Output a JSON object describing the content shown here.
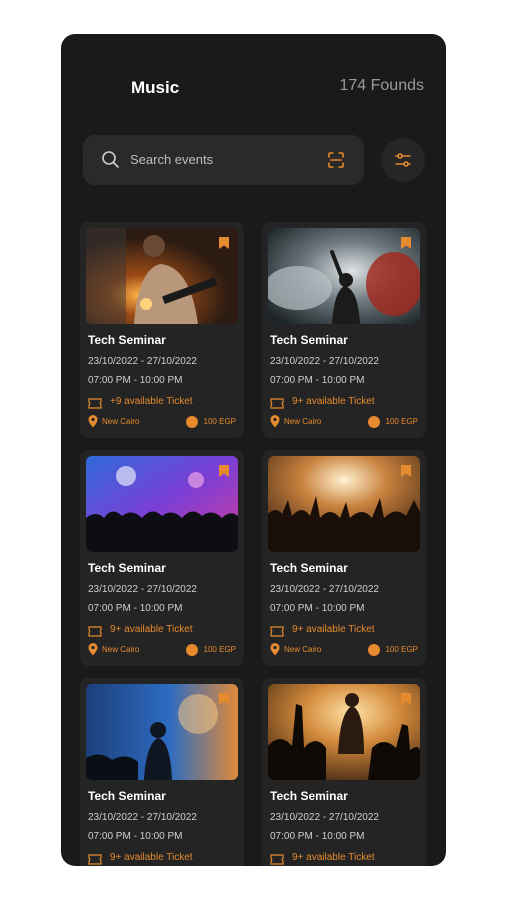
{
  "header": {
    "title": "Music",
    "results": "174 Founds"
  },
  "search": {
    "placeholder": "Search events"
  },
  "colors": {
    "background": "#1a1a1a",
    "card": "#242424",
    "accent": "#e58a2e",
    "text": "#ffffff"
  },
  "icons": {
    "search": "search-icon",
    "scan": "scan-icon",
    "filter": "filter-icon",
    "bookmark": "bookmark-icon",
    "ticket": "ticket-icon",
    "location": "location-pin-icon",
    "price": "coin-icon"
  },
  "cards": [
    {
      "title": "Tech Seminar",
      "date": "23/10/2022 - 27/10/2022",
      "time": "07:00 PM - 10:00 PM",
      "tickets": "+9 available Ticket",
      "location": "New Cairo",
      "price": "100 EGP"
    },
    {
      "title": "Tech Seminar",
      "date": "23/10/2022 - 27/10/2022",
      "time": "07:00 PM - 10:00 PM",
      "tickets": "9+ available Ticket",
      "location": "New Cairo",
      "price": "100 EGP"
    },
    {
      "title": "Tech Seminar",
      "date": "23/10/2022 - 27/10/2022",
      "time": "07:00 PM - 10:00 PM",
      "tickets": "9+ available Ticket",
      "location": "New Cairo",
      "price": "100 EGP"
    },
    {
      "title": "Tech Seminar",
      "date": "23/10/2022 - 27/10/2022",
      "time": "07:00 PM - 10:00 PM",
      "tickets": "9+ available Ticket",
      "location": "New Cairo",
      "price": "100 EGP"
    },
    {
      "title": "Tech Seminar",
      "date": "23/10/2022 - 27/10/2022",
      "time": "07:00 PM - 10:00 PM",
      "tickets": "9+ available Ticket",
      "location": "",
      "price": ""
    },
    {
      "title": "Tech Seminar",
      "date": "23/10/2022 - 27/10/2022",
      "time": "07:00 PM - 10:00 PM",
      "tickets": "9+ available Ticket",
      "location": "",
      "price": ""
    }
  ]
}
